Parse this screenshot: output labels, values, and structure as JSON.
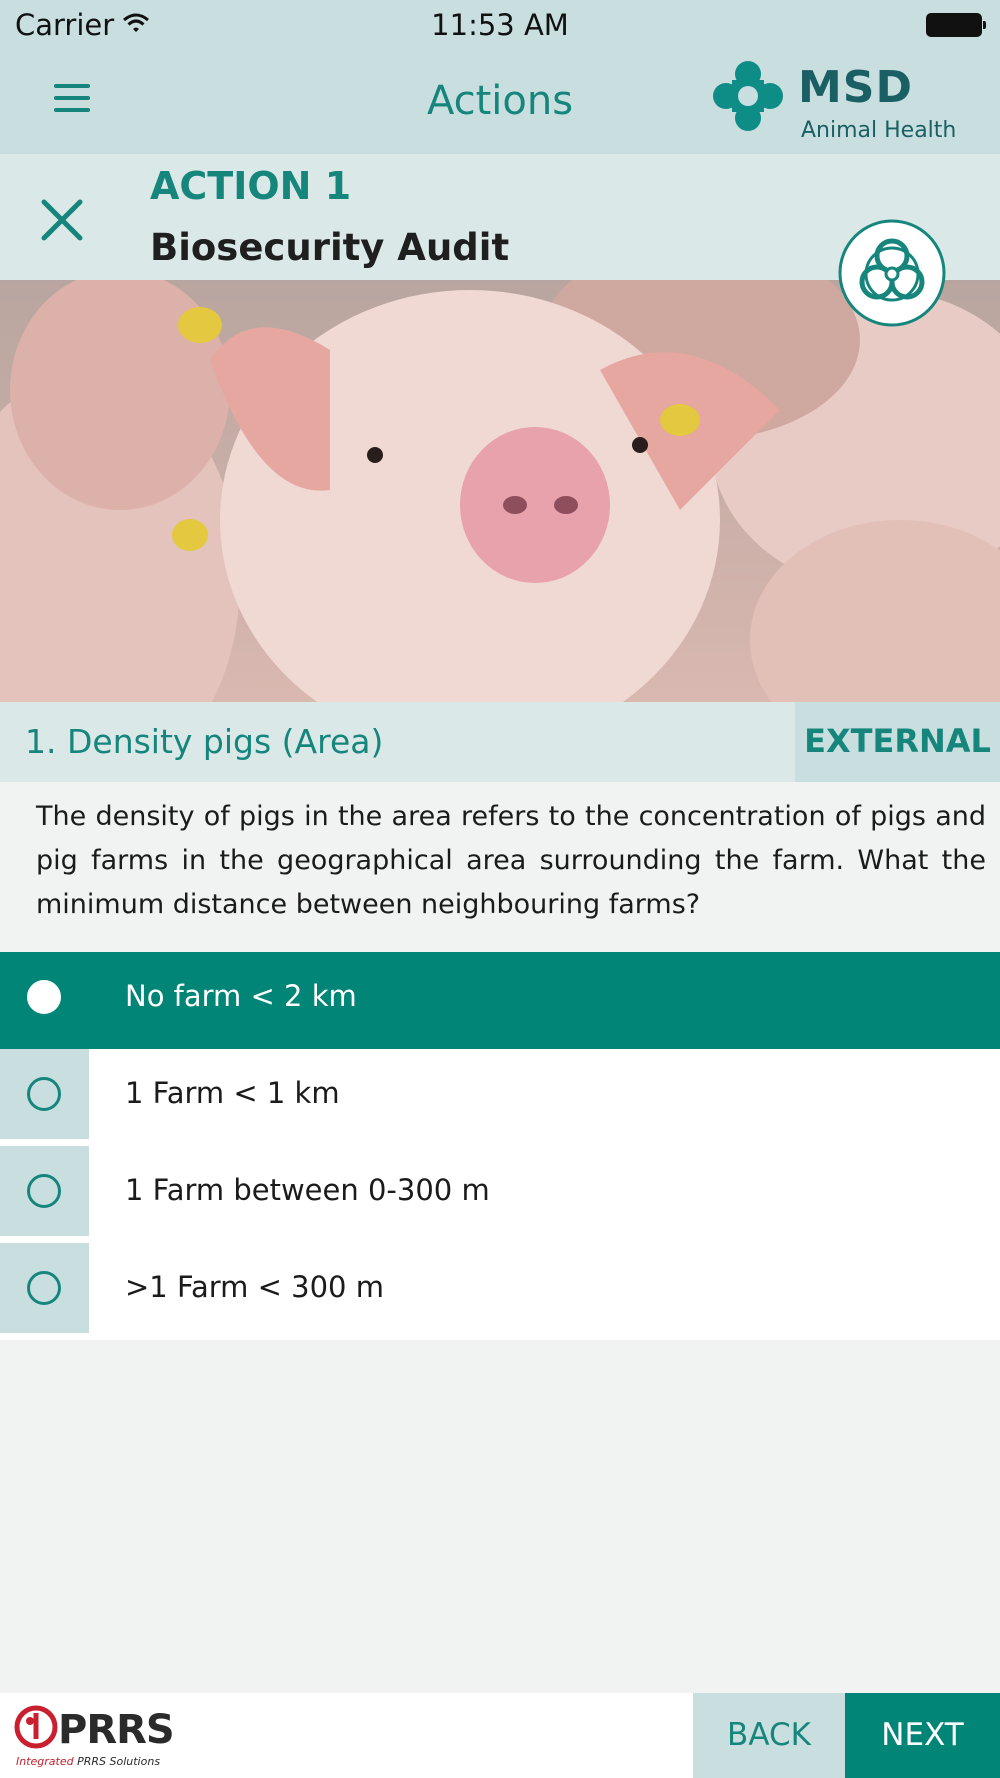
{
  "status_bar": {
    "carrier": "Carrier",
    "time": "11:53 AM"
  },
  "nav": {
    "title": "Actions",
    "logo_brand": "MSD",
    "logo_sub": "Animal Health"
  },
  "action": {
    "label": "ACTION 1",
    "title": "Biosecurity Audit",
    "icon": "biohazard-icon"
  },
  "hero": {
    "icon": "pigs-photo"
  },
  "question": {
    "title": "1. Density pigs (Area)",
    "category": "EXTERNAL",
    "text": "The density of pigs in the area refers to the concentration of pigs and pig farms in the geographical area surrounding the farm. What the minimum distance between neighbouring farms?"
  },
  "answers": [
    {
      "label": "No farm < 2 km",
      "selected": true
    },
    {
      "label": "1 Farm < 1 km",
      "selected": false
    },
    {
      "label": "1 Farm between 0-300 m",
      "selected": false
    },
    {
      "label": ">1 Farm < 300 m",
      "selected": false
    }
  ],
  "footer": {
    "logo_word": "PRRS",
    "logo_tag_accent": "Integrated",
    "logo_tag_rest": "PRRS Solutions",
    "back_label": "BACK",
    "next_label": "NEXT"
  },
  "colors": {
    "primary": "#008577",
    "primary_text": "#16867d",
    "header_bg": "#c9dfdf",
    "panel_bg": "#dbe8e8",
    "page_bg": "#f1f3f2"
  }
}
